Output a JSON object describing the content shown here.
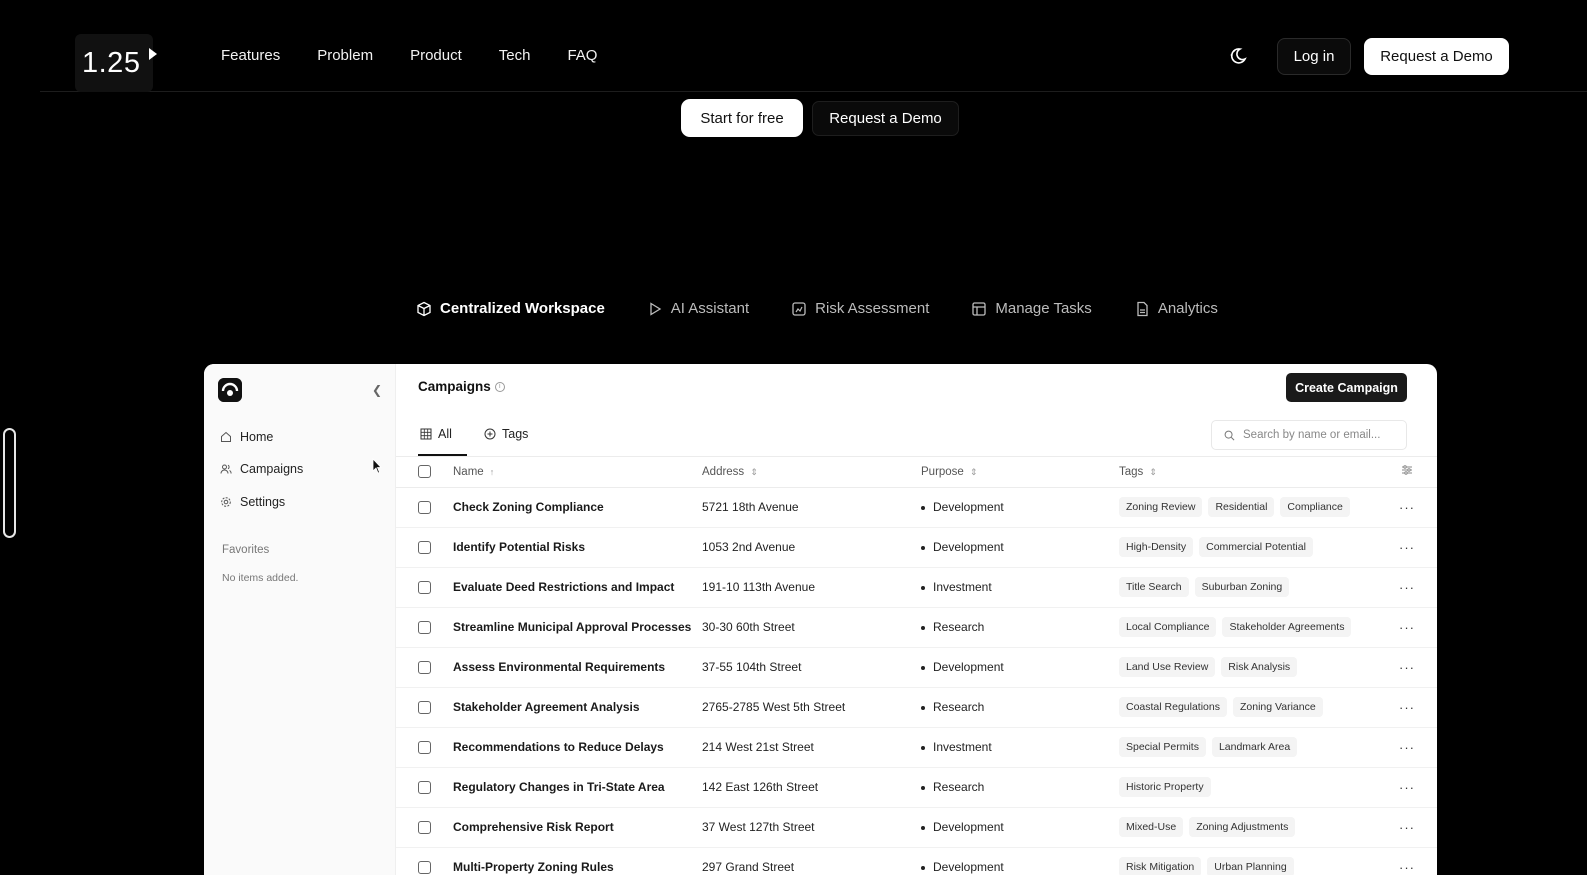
{
  "overlay": {
    "speed": "1.25"
  },
  "nav": {
    "links": [
      "Features",
      "Problem",
      "Product",
      "Tech",
      "FAQ"
    ],
    "login": "Log in",
    "demo": "Request a Demo"
  },
  "hero": {
    "start": "Start for free",
    "demo": "Request a Demo"
  },
  "features": [
    {
      "label": "Centralized Workspace",
      "icon": "cube-icon"
    },
    {
      "label": "AI Assistant",
      "icon": "play-icon"
    },
    {
      "label": "Risk Assessment",
      "icon": "chart-box-icon"
    },
    {
      "label": "Manage Tasks",
      "icon": "layout-icon"
    },
    {
      "label": "Analytics",
      "icon": "document-icon"
    }
  ],
  "app": {
    "sidebar": {
      "items": [
        "Home",
        "Campaigns",
        "Settings"
      ],
      "favorites_label": "Favorites",
      "favorites_empty": "No items added."
    },
    "title": "Campaigns",
    "create": "Create Campaign",
    "tabs": [
      "All",
      "Tags"
    ],
    "search_placeholder": "Search by name or email...",
    "columns": [
      "Name",
      "Address",
      "Purpose",
      "Tags"
    ],
    "rows": [
      {
        "name": "Check Zoning Compliance",
        "address": "5721 18th Avenue",
        "purpose": "Development",
        "tags": [
          "Zoning Review",
          "Residential",
          "Compliance"
        ]
      },
      {
        "name": "Identify Potential Risks",
        "address": "1053 2nd Avenue",
        "purpose": "Development",
        "tags": [
          "High-Density",
          "Commercial Potential"
        ]
      },
      {
        "name": "Evaluate Deed Restrictions and Impact",
        "address": "191-10 113th Avenue",
        "purpose": "Investment",
        "tags": [
          "Title Search",
          "Suburban Zoning"
        ]
      },
      {
        "name": "Streamline Municipal Approval Processes",
        "address": "30-30 60th Street",
        "purpose": "Research",
        "tags": [
          "Local Compliance",
          "Stakeholder Agreements"
        ]
      },
      {
        "name": "Assess Environmental Requirements",
        "address": "37-55 104th Street",
        "purpose": "Development",
        "tags": [
          "Land Use Review",
          "Risk Analysis"
        ]
      },
      {
        "name": "Stakeholder Agreement Analysis",
        "address": "2765-2785 West 5th Street",
        "purpose": "Research",
        "tags": [
          "Coastal Regulations",
          "Zoning Variance"
        ]
      },
      {
        "name": "Recommendations to Reduce Delays",
        "address": "214 West 21st Street",
        "purpose": "Investment",
        "tags": [
          "Special Permits",
          "Landmark Area"
        ]
      },
      {
        "name": "Regulatory Changes in Tri-State Area",
        "address": "142 East 126th Street",
        "purpose": "Research",
        "tags": [
          "Historic Property"
        ]
      },
      {
        "name": "Comprehensive Risk Report",
        "address": "37 West 127th Street",
        "purpose": "Development",
        "tags": [
          "Mixed-Use",
          "Zoning Adjustments"
        ]
      },
      {
        "name": "Multi-Property Zoning Rules",
        "address": "297 Grand Street",
        "purpose": "Development",
        "tags": [
          "Risk Mitigation",
          "Urban Planning"
        ]
      }
    ]
  }
}
